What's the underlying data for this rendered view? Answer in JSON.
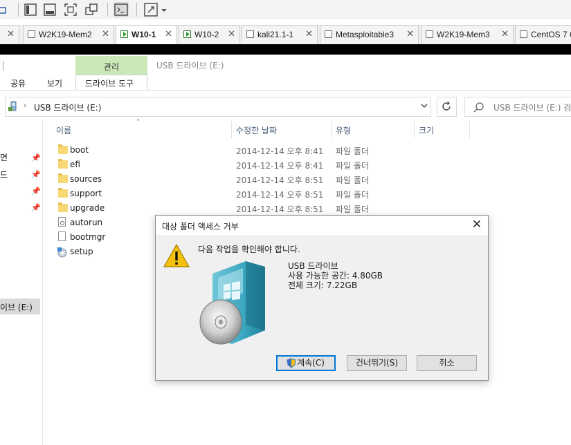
{
  "vm_tabs": [
    {
      "label": "W2K19-Mem2",
      "active": false
    },
    {
      "label": "W10-1",
      "active": true
    },
    {
      "label": "W10-2",
      "active": false
    },
    {
      "label": "kali21.1-1",
      "active": false
    },
    {
      "label": "Metasploitable3",
      "active": false
    },
    {
      "label": "W2K19-Mem3",
      "active": false
    },
    {
      "label": "CentOS 7 6",
      "active": false
    }
  ],
  "ribbon": {
    "context_tab": "관리",
    "window_title": "USB 드라이브 (E:)",
    "tabs": [
      "공유",
      "보기",
      "드라이브 도구"
    ]
  },
  "address": {
    "path": "USB 드라이브 (E:)",
    "search_placeholder": "USB 드라이브 (E:) 검"
  },
  "nav": {
    "items": [
      "면",
      "드",
      "",
      ""
    ],
    "selected_label": "이브 (E:)"
  },
  "columns": [
    "이름",
    "수정한 날짜",
    "유형",
    "크기"
  ],
  "files": [
    {
      "name": "boot",
      "date": "2014-12-14 오후 8:41",
      "type": "파일 폴더",
      "icon": "folder"
    },
    {
      "name": "efi",
      "date": "2014-12-14 오후 8:41",
      "type": "파일 폴더",
      "icon": "folder"
    },
    {
      "name": "sources",
      "date": "2014-12-14 오후 8:51",
      "type": "파일 폴더",
      "icon": "folder"
    },
    {
      "name": "support",
      "date": "2014-12-14 오후 8:51",
      "type": "파일 폴더",
      "icon": "folder"
    },
    {
      "name": "upgrade",
      "date": "2014-12-14 오후 8:51",
      "type": "파일 폴더",
      "icon": "folder"
    },
    {
      "name": "autorun",
      "date": "",
      "type": "",
      "icon": "settings-file"
    },
    {
      "name": "bootmgr",
      "date": "",
      "type": "",
      "icon": "file"
    },
    {
      "name": "setup",
      "date": "",
      "type": "",
      "icon": "setup"
    }
  ],
  "dialog": {
    "title": "대상 폴더 액세스 거부",
    "message": "다음 작업을 확인해야 합니다.",
    "drive_name": "USB 드라이브",
    "free_space": "사용 가능한 공간: 4.80GB",
    "total_size": "전체 크기: 7.22GB",
    "buttons": {
      "continue": "계속(C)",
      "skip": "건너뛰기(S)",
      "cancel": "취소"
    }
  },
  "colors": {
    "context_tab": "#cde8b8",
    "dialog_bg": "#f0f0f0",
    "accent": "#0078d7"
  }
}
